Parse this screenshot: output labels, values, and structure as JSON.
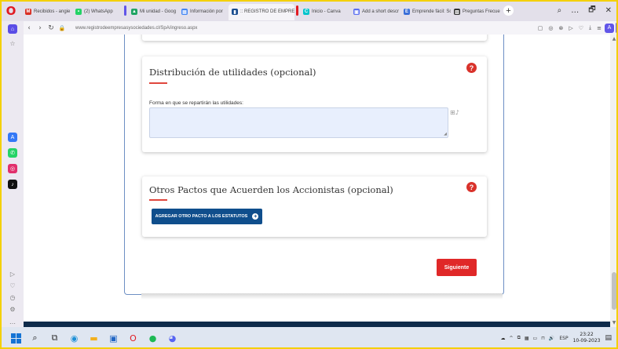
{
  "browser": {
    "tabs": [
      {
        "label": "Recibidos - angie",
        "favicon_color": "#d93025",
        "favicon_glyph": "M"
      },
      {
        "label": "(2) WhatsApp",
        "favicon_color": "#25d366",
        "favicon_glyph": "•"
      },
      {
        "label": "Mi unidad - Goog",
        "favicon_color": "#1fa463",
        "favicon_glyph": "▲"
      },
      {
        "label": "Información por",
        "favicon_color": "#4285f4",
        "favicon_glyph": "▤"
      },
      {
        "label": ":: REGISTRO DE EMPRESA",
        "favicon_color": "#1a4d8f",
        "favicon_glyph": "▮",
        "active": true
      },
      {
        "label": "Inicio - Canva",
        "favicon_color": "#00c4cc",
        "favicon_glyph": "C"
      },
      {
        "label": "Add a short descr",
        "favicon_color": "#5b6ef0",
        "favicon_glyph": "▣"
      },
      {
        "label": "Emprende fácil: Sc",
        "favicon_color": "#3a6fd8",
        "favicon_glyph": "E"
      },
      {
        "label": "Preguntas Frecue",
        "favicon_color": "#333333",
        "favicon_glyph": "▥"
      }
    ],
    "window_controls": [
      "⌕",
      "…",
      "🗗",
      "✕"
    ],
    "url": "www.registrodeempresasysociedades.cl/SpA/ingreso.aspx",
    "address_icons": [
      "▢",
      "◎",
      "⊗",
      "▷",
      "♡",
      "⤓",
      "≡"
    ],
    "addr_ext_glyph": "A"
  },
  "page": {
    "card_distribution": {
      "title": "Distribución de utilidades (opcional)",
      "help": "?",
      "field_label": "Forma en que se repartirán las utilidades:",
      "field_value": "",
      "grip": "◢",
      "assist": "⊞♪"
    },
    "card_pacts": {
      "title": "Otros Pactos que Acuerden los Accionistas (opcional)",
      "help": "?",
      "button_label": "AGREGAR OTRO PACTO A LOS ESTATUTOS",
      "button_glyph": "+"
    },
    "next_button": "Siguiente",
    "scroll_up": "▲",
    "scroll_down": "▼"
  },
  "sidebar": {
    "icons": [
      {
        "name": "home",
        "glyph": "⌂"
      },
      {
        "name": "star",
        "glyph": "☆"
      },
      {
        "name": "app-store",
        "glyph": "A",
        "color": "#3478f6"
      },
      {
        "name": "whatsapp",
        "glyph": "✆",
        "color": "#25d366"
      },
      {
        "name": "instagram",
        "glyph": "◎",
        "color": "#e1306c"
      },
      {
        "name": "tiktok",
        "glyph": "♪",
        "color": "#111111"
      },
      {
        "name": "player",
        "glyph": "▷"
      },
      {
        "name": "heart",
        "glyph": "♡"
      },
      {
        "name": "history",
        "glyph": "◷"
      },
      {
        "name": "settings",
        "glyph": "⚙"
      },
      {
        "name": "more",
        "glyph": "…"
      }
    ]
  },
  "taskbar": {
    "icons": [
      {
        "name": "search",
        "glyph": "⌕",
        "color": "#111111"
      },
      {
        "name": "task-view",
        "glyph": "⧉",
        "color": "#333333"
      },
      {
        "name": "edge",
        "glyph": "◉",
        "color": "#1d8fd6"
      },
      {
        "name": "file-explorer",
        "glyph": "▬",
        "color": "#f2b01e"
      },
      {
        "name": "store",
        "glyph": "▣",
        "color": "#2266c4"
      },
      {
        "name": "opera",
        "glyph": "O",
        "color": "#e11b22"
      },
      {
        "name": "spotify",
        "glyph": "●",
        "color": "#1db954"
      },
      {
        "name": "discord",
        "glyph": "◕",
        "color": "#5865f2"
      }
    ],
    "tray_icons": [
      "☁",
      "^",
      "⧉",
      "▦",
      "▭",
      "⊓",
      "🔊"
    ],
    "language": "ESP",
    "time": "23:22",
    "date": "10-09-2023",
    "notification": "▤"
  }
}
